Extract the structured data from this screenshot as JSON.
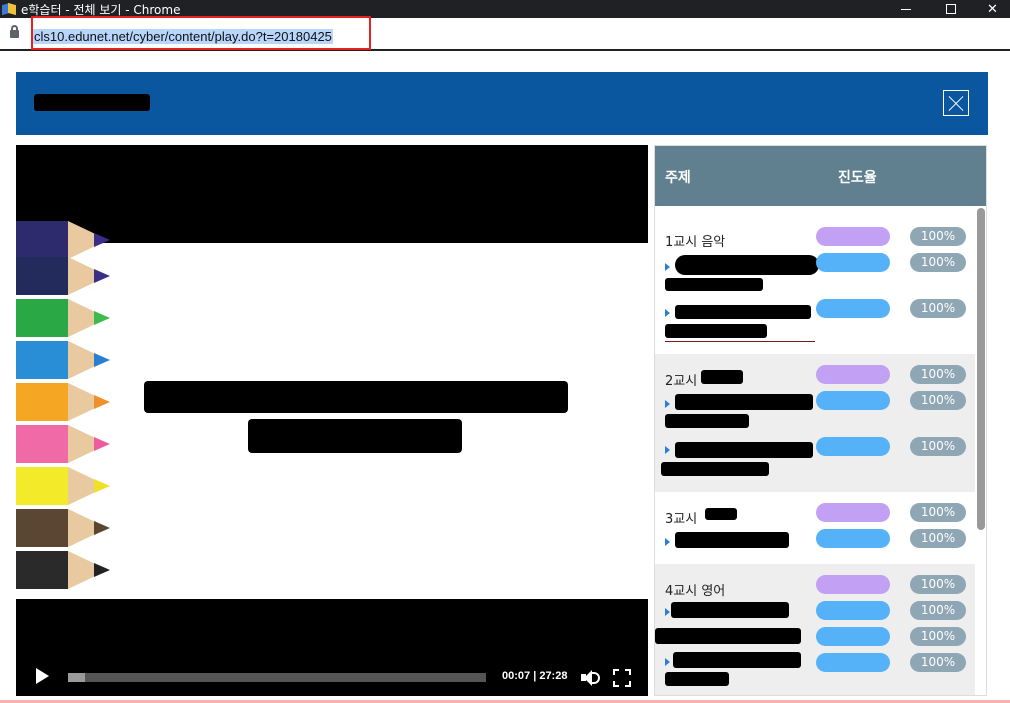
{
  "window": {
    "title": "e학습터 - 전체 보기 - Chrome",
    "controls": {
      "minimize": "—",
      "maximize": "☐",
      "close": "✕"
    }
  },
  "address_bar": {
    "url": "cls10.edunet.net/cyber/content/play.do?t=20180425"
  },
  "player": {
    "close_icon": "close-icon",
    "time_display": "00:07 | 27:28",
    "progress_fraction": 0.04
  },
  "panel": {
    "header": {
      "topic": "주제",
      "progress": "진도율"
    },
    "lessons": [
      {
        "title": "1교시 음악",
        "overall": "100%",
        "items": [
          "100%",
          "100%"
        ]
      },
      {
        "title": "2교시",
        "overall": "100%",
        "items": [
          "100%",
          "100%"
        ]
      },
      {
        "title": "3교시",
        "overall": "100%",
        "items": [
          "100%"
        ]
      },
      {
        "title": "4교시 영어",
        "overall": "100%",
        "items": [
          "100%",
          "100%",
          "100%"
        ]
      }
    ]
  },
  "colors": {
    "header_blue": "#0a57a0",
    "panel_header": "#61808f",
    "bar_purple": "#c2a0f4",
    "bar_blue": "#55b2f8",
    "pct_badge": "#8fa6b5",
    "url_highlight_border": "#e8201f"
  }
}
